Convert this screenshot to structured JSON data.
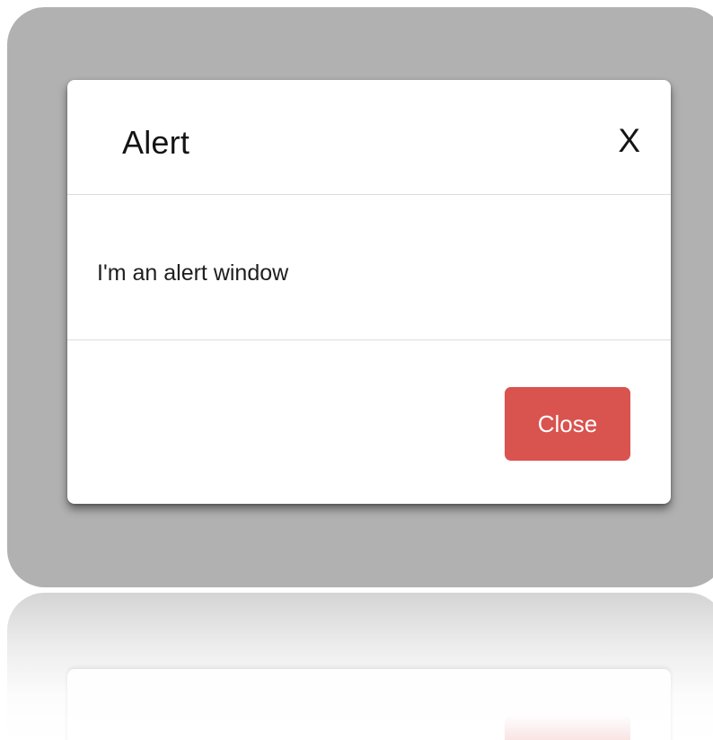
{
  "dialog": {
    "title": "Alert",
    "close_icon_label": "X",
    "message": "I'm an alert window",
    "close_button_label": "Close"
  },
  "colors": {
    "backdrop": "#b1b1b1",
    "modal_background": "#ffffff",
    "close_button": "#d9534f",
    "divider": "#dcdcdc",
    "text": "#141414"
  },
  "icons": {
    "dismiss": "close-icon"
  }
}
